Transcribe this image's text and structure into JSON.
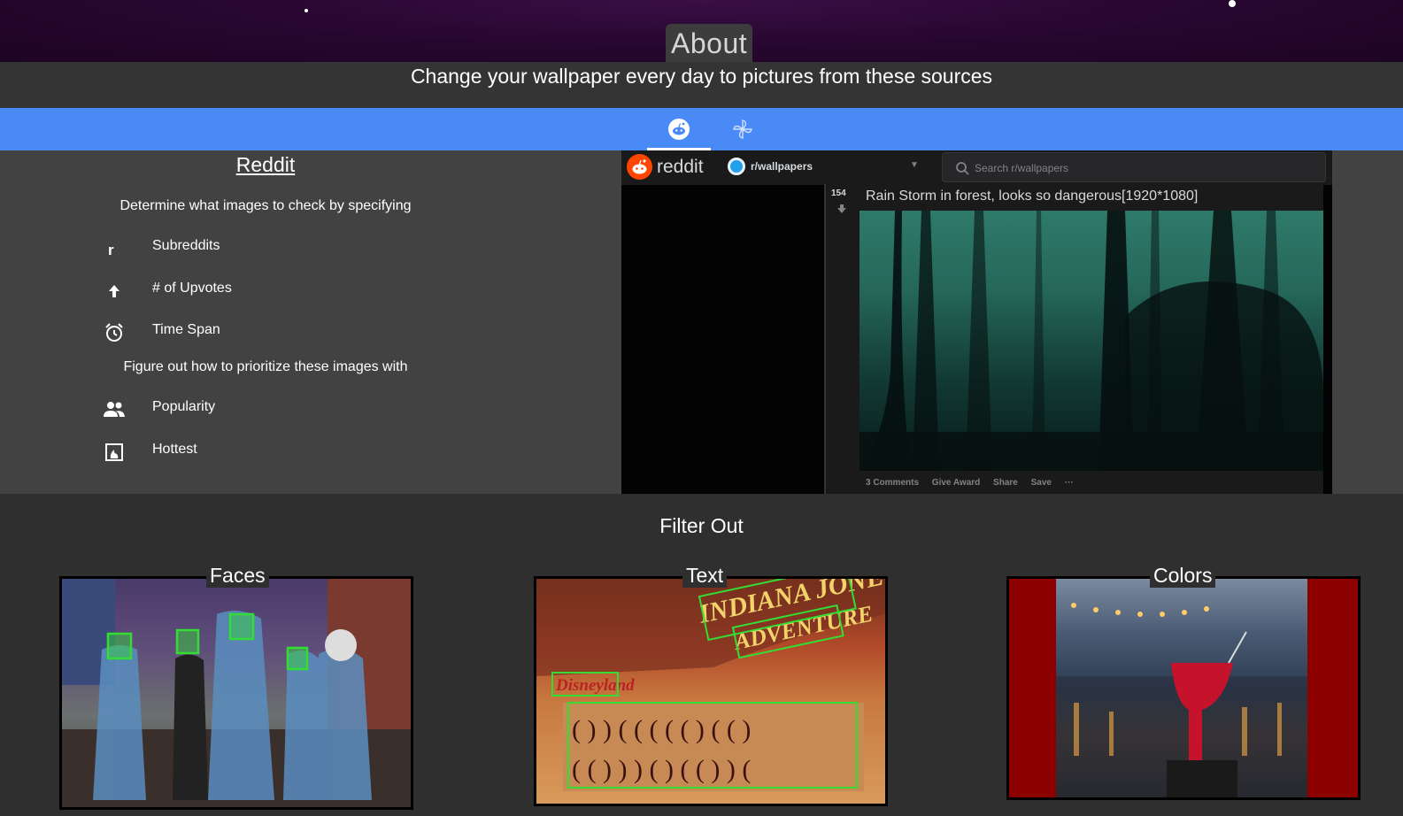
{
  "header": {
    "title": "About",
    "subtitle": "Change your wallpaper every day to pictures from these sources"
  },
  "tabs": [
    {
      "name": "reddit",
      "icon": "reddit-icon",
      "active": true
    },
    {
      "name": "pinwheel",
      "icon": "pinwheel-icon",
      "active": false
    }
  ],
  "reddit": {
    "heading": "Reddit",
    "intro": "Determine what images to check by specifying",
    "criteria": [
      {
        "label": "Subreddits",
        "icon": "subreddit-r-icon"
      },
      {
        "label": "# of Upvotes",
        "icon": "arrow-up-icon"
      },
      {
        "label": "Time Span",
        "icon": "alarm-clock-icon"
      }
    ],
    "prioritize_intro": "Figure out how to prioritize these images with",
    "priorities": [
      {
        "label": "Popularity",
        "icon": "people-icon"
      },
      {
        "label": "Hottest",
        "icon": "fire-image-icon"
      }
    ],
    "screenshot": {
      "wordmark": "reddit",
      "subreddit": "r/wallpapers",
      "search_placeholder": "Search r/wallpapers",
      "votes": "154",
      "post_title": "Rain Storm in forest, looks so dangerous[1920*1080]",
      "actions": [
        "3 Comments",
        "Give Award",
        "Share",
        "Save",
        "···"
      ]
    }
  },
  "filter": {
    "title": "Filter Out",
    "cards": [
      {
        "label": "Faces"
      },
      {
        "label": "Text"
      },
      {
        "label": "Colors"
      }
    ],
    "text_card_words": [
      "INDIANA JONES",
      "ADVENTURE",
      "Disneyland"
    ]
  },
  "colors": {
    "tab_bar": "#4a8af7",
    "reddit_orange": "#ff4500",
    "detection_green": "#33dd33",
    "colors_card_bg": "#8c0000"
  }
}
